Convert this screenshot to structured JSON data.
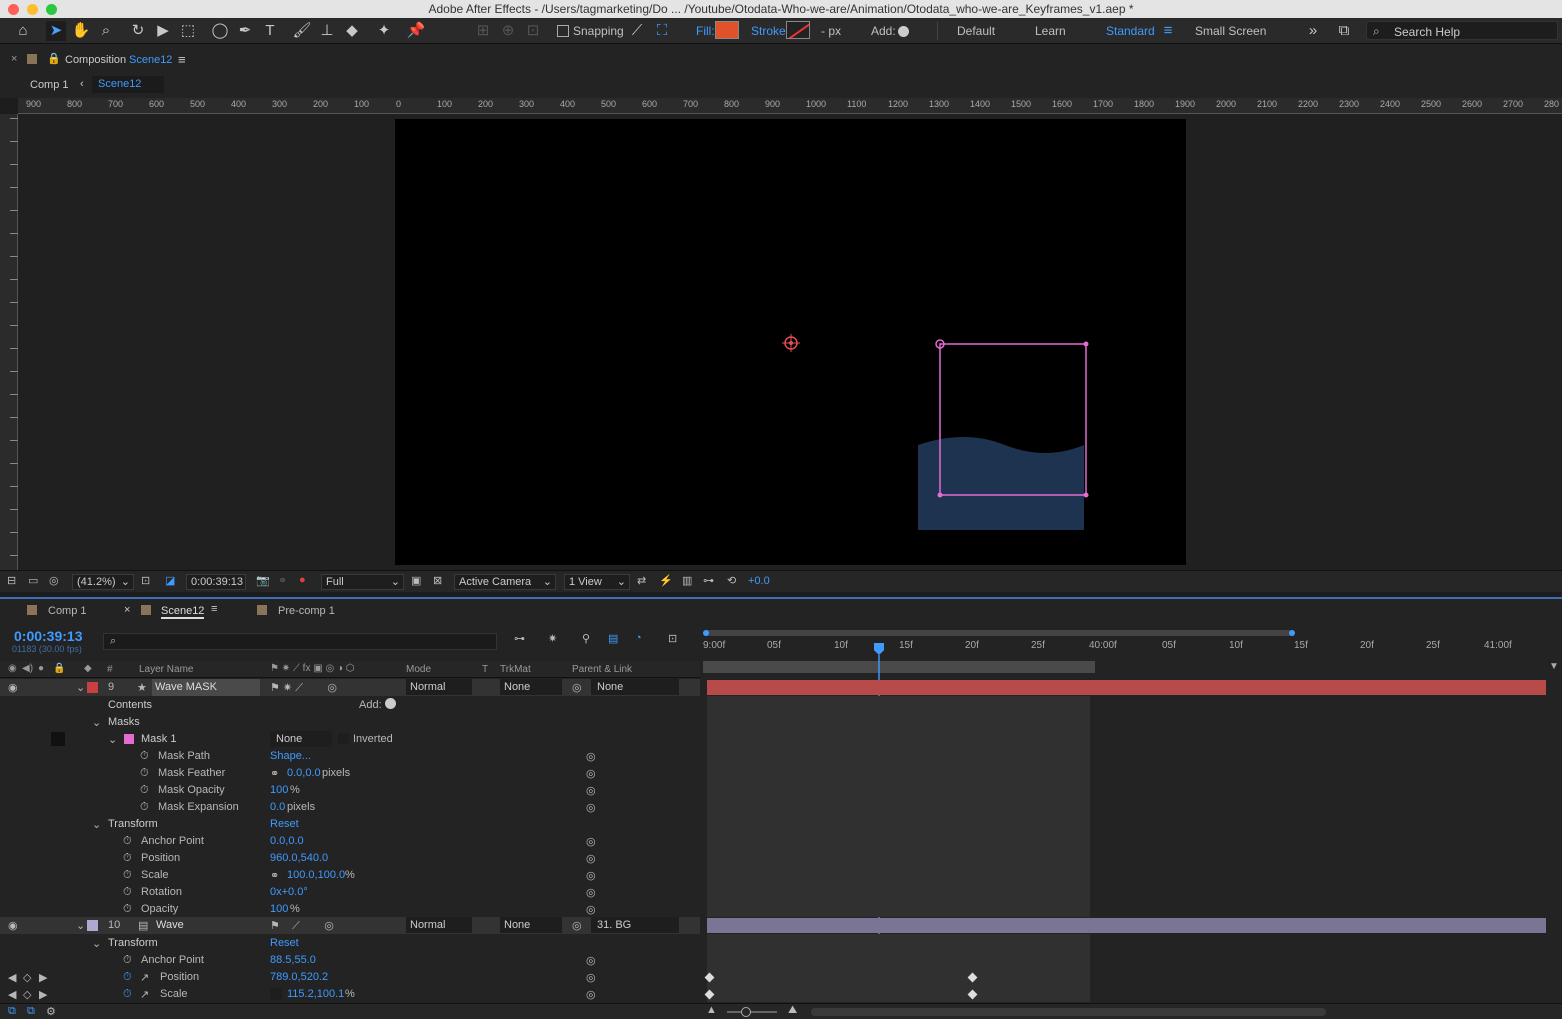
{
  "window": {
    "title": "Adobe After Effects - /Users/tagmarketing/Do ... /Youtube/Otodata-Who-we-are/Animation/Otodata_who-we-are_Keyframes_v1.aep *"
  },
  "toolbar": {
    "snapping_label": "Snapping",
    "fill_label": "Fill:",
    "fill_color": "#e0522a",
    "stroke_label": "Stroke:",
    "stroke_width": "- px",
    "add_label": "Add:",
    "workspaces": [
      "Default",
      "Learn",
      "Standard",
      "Small Screen"
    ],
    "active_workspace": "Standard",
    "search_placeholder": "Search Help"
  },
  "comp_panel": {
    "panel_label": "Composition",
    "comp_name": "Scene12",
    "breadcrumb": [
      "Comp 1",
      "Scene12"
    ]
  },
  "ruler": {
    "labels": [
      "900",
      "800",
      "700",
      "600",
      "500",
      "400",
      "300",
      "200",
      "100",
      "0",
      "100",
      "200",
      "300",
      "400",
      "500",
      "600",
      "700",
      "800",
      "900",
      "1000",
      "1100",
      "1200",
      "1300",
      "1400",
      "1500",
      "1600",
      "1700",
      "1800",
      "1900",
      "2000",
      "2100",
      "2200",
      "2300",
      "2400",
      "2500",
      "2600",
      "2700",
      "280"
    ]
  },
  "viewer_footer": {
    "zoom": "(41.2%)",
    "timecode": "0:00:39:13",
    "resolution": "Full",
    "camera": "Active Camera",
    "view": "1 View",
    "exposure": "+0.0"
  },
  "timeline": {
    "tabs": [
      "Comp 1",
      "Scene12",
      "Pre-comp 1"
    ],
    "active_tab": "Scene12",
    "timecode": "0:00:39:13",
    "frame_info": "01183 (30.00 fps)",
    "columns": {
      "num": "#",
      "layer_name": "Layer Name",
      "mode": "Mode",
      "t": "T",
      "trkmat": "TrkMat",
      "parent": "Parent & Link"
    },
    "ruler_labels": [
      "9:00f",
      "05f",
      "10f",
      "15f",
      "20f",
      "25f",
      "40:00f",
      "05f",
      "10f",
      "15f",
      "20f",
      "25f",
      "41:00f"
    ],
    "layers": [
      {
        "number": "9",
        "name": "Wave MASK",
        "mode": "Normal",
        "trkmat": "None",
        "parent": "None",
        "label_color": "#c94040"
      },
      {
        "number": "10",
        "name": "Wave",
        "mode": "Normal",
        "trkmat": "None",
        "parent": "31. BG",
        "label_color": "#b0a8d0"
      }
    ],
    "props": {
      "contents": "Contents",
      "add": "Add:",
      "masks": "Masks",
      "mask1": "Mask 1",
      "mask1_mode": "None",
      "inverted": "Inverted",
      "mask_path": "Mask Path",
      "mask_path_val": "Shape...",
      "mask_feather": "Mask Feather",
      "mask_feather_val": "0.0,0.0",
      "pixels": "pixels",
      "mask_opacity": "Mask Opacity",
      "mask_opacity_val": "100",
      "mask_expansion": "Mask Expansion",
      "mask_expansion_val": "0.0",
      "transform": "Transform",
      "reset": "Reset",
      "anchor_point": "Anchor Point",
      "anchor_val": "0.0,0.0",
      "position": "Position",
      "position_val": "960.0,540.0",
      "scale": "Scale",
      "scale_val": "100.0,100.0",
      "rotation": "Rotation",
      "rotation_val": "0x+0.0°",
      "opacity": "Opacity",
      "opacity_val": "100",
      "percent": "%",
      "wave_anchor_val": "88.5,55.0",
      "wave_position_val": "789.0,520.2",
      "wave_scale_val": "115.2,100.1"
    }
  }
}
